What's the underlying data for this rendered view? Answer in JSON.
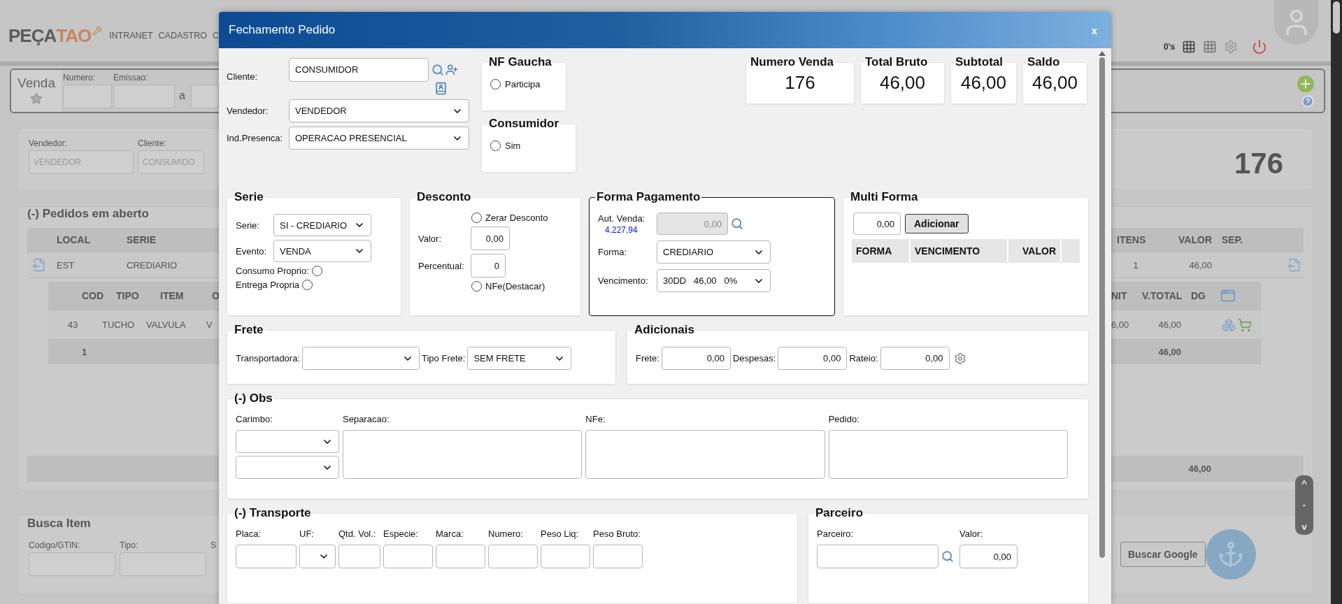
{
  "background": {
    "logo": {
      "first": "PEÇA",
      "second": "TAO"
    },
    "nav": [
      "INTRANET",
      "CADASTRO",
      "C"
    ],
    "counter": "0's",
    "venda": {
      "title": "Venda",
      "fields": [
        "Numero:",
        "Emissao:"
      ],
      "separator": "a"
    },
    "filters": [
      {
        "label": "Vendedor:",
        "value": "VENDEDOR"
      },
      {
        "label": "Cliente:",
        "value": "CONSUMIDO"
      }
    ],
    "order_number": "176",
    "pedidos": {
      "title": "(-) Pedidos em aberto",
      "left_columns": [
        "LOCAL",
        "SERIE"
      ],
      "left_row": [
        "EST",
        "CREDIARIO"
      ],
      "right_columns": [
        "ITENS",
        "VALOR",
        "SEP."
      ],
      "right_row": [
        "1",
        "46,00"
      ],
      "items": {
        "left_columns": [
          "COD",
          "TIPO",
          "ITEM",
          "O"
        ],
        "left_row": [
          "43",
          "TUCHO",
          "VALVULA",
          "V"
        ],
        "left_total": "1",
        "right_columns": [
          "NIT",
          "V.TOTAL",
          "DG"
        ],
        "right_row": [
          "6,00",
          "46,00"
        ],
        "right_total": "46,00"
      },
      "footer_total": "46,00"
    },
    "busca": {
      "title": "Busca Item",
      "fields": [
        "Codigo/GTIN:",
        "Tipo:",
        "S"
      ],
      "button": "Buscar Google"
    },
    "scroll_buttons": [
      "^",
      "-",
      "v"
    ]
  },
  "modal": {
    "title": "Fechamento Pedido",
    "close": "x",
    "cliente": {
      "label": "Cliente:",
      "value": "CONSUMIDOR"
    },
    "selects": [
      {
        "label": "Vendedor:",
        "value": "VENDEDOR"
      },
      {
        "label": "Ind.Presenca:",
        "value": "OPERACAO PRESENCIAL"
      }
    ],
    "option_cards": [
      {
        "title": "NF Gaucha",
        "option": "Participa",
        "checked": false
      },
      {
        "title": "Consumidor",
        "option": "Sim",
        "checked": false
      }
    ],
    "totals": [
      {
        "label": "Numero Venda",
        "value": "176"
      },
      {
        "label": "Total Bruto",
        "value": "46,00"
      },
      {
        "label": "Subtotal",
        "value": "46,00"
      },
      {
        "label": "Saldo",
        "value": "46,00"
      }
    ],
    "serie": {
      "title": "Serie",
      "fields": [
        {
          "label": "Serie:",
          "value": "SI - CREDIARIO"
        },
        {
          "label": "Evento:",
          "value": "VENDA"
        }
      ],
      "options": [
        {
          "label": "Consumo Proprio:",
          "checked": false
        },
        {
          "label": "Entrega Propria",
          "checked": false
        }
      ]
    },
    "desconto": {
      "title": "Desconto",
      "zerar": {
        "label": "Zerar Desconto",
        "checked": false
      },
      "valor": {
        "label": "Valor:",
        "value": "0,00"
      },
      "percentual": {
        "label": "Percentual:",
        "value": "0"
      },
      "nfe": {
        "label": "NFe(Destacar)",
        "checked": false
      }
    },
    "pagamento": {
      "title": "Forma Pagamento",
      "aut_label": "Aut. Venda:",
      "aut_limit": "4.227,94",
      "aut_value": "0,00",
      "forma": {
        "label": "Forma:",
        "value": "CREDIARIO"
      },
      "vencimento": {
        "label": "Vencimento:",
        "value": "30DD   46,00   0%"
      }
    },
    "multi": {
      "title": "Multi Forma",
      "value": "0,00",
      "button": "Adicionar",
      "columns": [
        "FORMA",
        "VENCIMENTO",
        "VALOR"
      ]
    },
    "frete": {
      "title": "Frete",
      "transportadora": "Transportadora:",
      "tipo": {
        "label": "Tipo Frete:",
        "value": "SEM FRETE"
      }
    },
    "adicionais": {
      "title": "Adicionais",
      "fields": [
        {
          "label": "Frete:",
          "value": "0,00"
        },
        {
          "label": "Despesas:",
          "value": "0,00"
        },
        {
          "label": "Rateio:",
          "value": "0,00"
        }
      ]
    },
    "obs": {
      "title": "(-) Obs",
      "carimbo": "Carimbo:",
      "notes": [
        "Separacao:",
        "NFe:",
        "Pedido:"
      ]
    },
    "transporte": {
      "title": "(-) Transporte",
      "fields": [
        {
          "label": "Placa:",
          "kind": "input"
        },
        {
          "label": "UF:",
          "kind": "select"
        },
        {
          "label": "Qtd. Vol.:",
          "kind": "input"
        },
        {
          "label": "Especie:",
          "kind": "input"
        },
        {
          "label": "Marca:",
          "kind": "input"
        },
        {
          "label": "Numero:",
          "kind": "input"
        },
        {
          "label": "Peso Liq:",
          "kind": "input"
        },
        {
          "label": "Peso Bruto:",
          "kind": "input"
        }
      ]
    },
    "parceiro": {
      "title": "Parceiro",
      "label": "Parceiro:",
      "valor_label": "Valor:",
      "valor": "0,00"
    }
  }
}
